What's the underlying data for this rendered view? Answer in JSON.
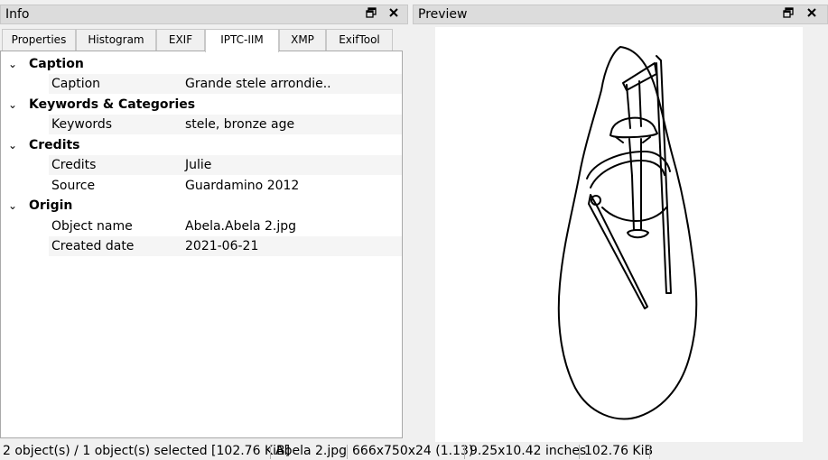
{
  "info_panel": {
    "title": "Info",
    "float_icon": "float-window-icon",
    "close_icon": "close-icon",
    "tabs": [
      "Properties",
      "Histogram",
      "EXIF",
      "IPTC-IIM",
      "XMP",
      "ExifTool"
    ],
    "active_tab": "IPTC-IIM",
    "sections": [
      {
        "title": "Caption",
        "rows": [
          {
            "key": "Caption",
            "value": "Grande stele arrondie.."
          }
        ]
      },
      {
        "title": "Keywords & Categories",
        "rows": [
          {
            "key": "Keywords",
            "value": "stele,  bronze age"
          }
        ]
      },
      {
        "title": "Credits",
        "rows": [
          {
            "key": "Credits",
            "value": "Julie"
          },
          {
            "key": "Source",
            "value": "Guardamino 2012"
          }
        ]
      },
      {
        "title": "Origin",
        "rows": [
          {
            "key": "Object name",
            "value": "Abela.Abela 2.jpg"
          },
          {
            "key": "Created date",
            "value": "2021-06-21"
          }
        ]
      }
    ]
  },
  "preview_panel": {
    "title": "Preview",
    "float_icon": "float-window-icon",
    "close_icon": "close-icon"
  },
  "status_bar": {
    "selection": "2 object(s) / 1 object(s) selected [102.76 KiB]",
    "filename": "Abela 2.jpg",
    "dimensions": "666x750x24 (1.13)",
    "print_size": "9.25x10.42 inches",
    "file_size": "102.76 KiB"
  }
}
